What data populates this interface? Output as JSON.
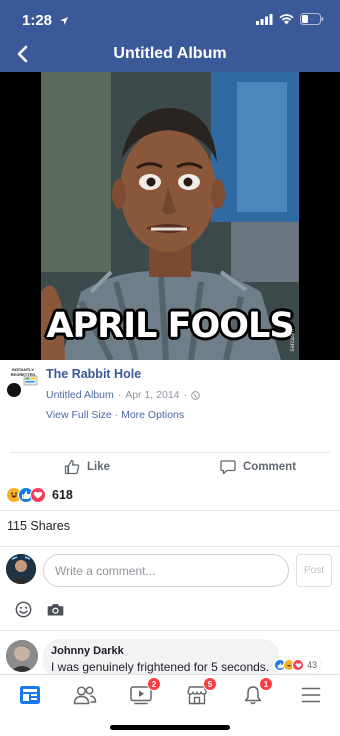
{
  "status_bar": {
    "time": "1:28"
  },
  "nav": {
    "title": "Untitled Album"
  },
  "photo": {
    "caption": "APRIL FOOLS",
    "watermark": "sarcasm"
  },
  "post": {
    "page_avatar_text": "INSTANTLY REGRETTED",
    "page_name": "The Rabbit Hole",
    "album_link": "Untitled Album",
    "separator": "·",
    "date": "Apr 1, 2014",
    "view_full_size": "View Full Size",
    "more_options": "More Options"
  },
  "actions": {
    "like": "Like",
    "comment": "Comment"
  },
  "reactions": {
    "count": "618",
    "types": [
      "haha",
      "like",
      "love"
    ]
  },
  "shares": {
    "text": "115 Shares"
  },
  "composer": {
    "placeholder": "Write a comment...",
    "post_label": "Post"
  },
  "comments": [
    {
      "author": "Johnny Darkk",
      "text": "I was genuinely frightened for 5 seconds.",
      "reaction_count": "43"
    }
  ],
  "tab_bar": {
    "tabs": [
      {
        "name": "news-feed",
        "badge": ""
      },
      {
        "name": "friends",
        "badge": ""
      },
      {
        "name": "watch",
        "badge": "2"
      },
      {
        "name": "marketplace",
        "badge": "5"
      },
      {
        "name": "notifications",
        "badge": "1"
      },
      {
        "name": "menu",
        "badge": ""
      }
    ]
  },
  "colors": {
    "brand": "#3b5998",
    "badge": "#fa3e3e",
    "link": "#4b67a1"
  }
}
